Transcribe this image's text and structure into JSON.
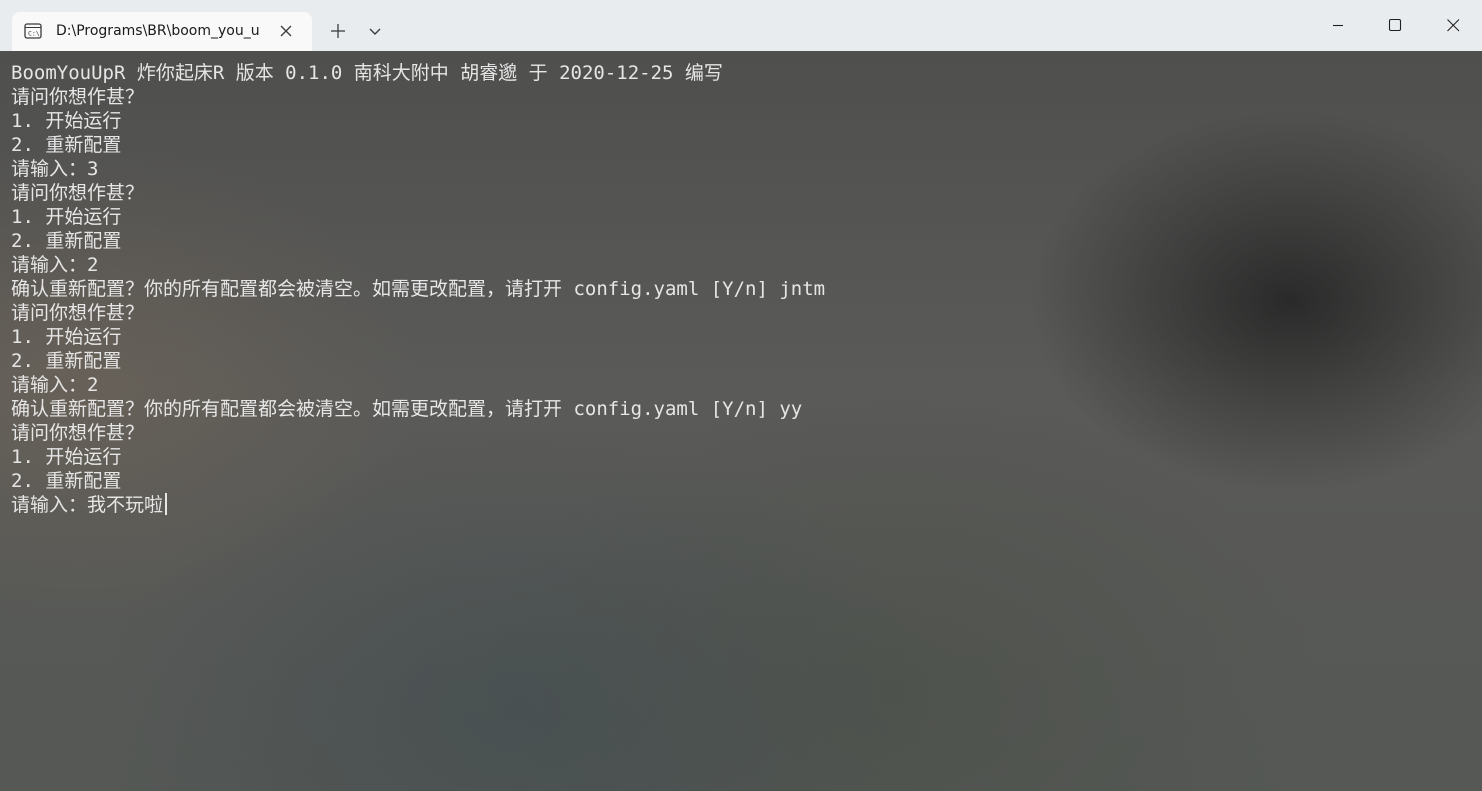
{
  "window": {
    "tab_title": "D:\\Programs\\BR\\boom_you_u",
    "icons": {
      "tab": "terminal-icon",
      "close_tab": "close-icon",
      "new_tab": "plus-icon",
      "dropdown": "chevron-down-icon",
      "minimize": "minimize-icon",
      "maximize": "maximize-icon",
      "close_window": "close-icon"
    }
  },
  "terminal": {
    "lines": [
      "BoomYouUpR 炸你起床R 版本 0.1.0 南科大附中 胡睿邈 于 2020-12-25 编写",
      "请问你想作甚？",
      "1. 开始运行",
      "2. 重新配置",
      "请输入：3",
      "请问你想作甚？",
      "1. 开始运行",
      "2. 重新配置",
      "请输入：2",
      "确认重新配置？你的所有配置都会被清空。如需更改配置，请打开 config.yaml [Y/n] jntm",
      "请问你想作甚？",
      "1. 开始运行",
      "2. 重新配置",
      "请输入：2",
      "确认重新配置？你的所有配置都会被清空。如需更改配置，请打开 config.yaml [Y/n] yy",
      "请问你想作甚？",
      "1. 开始运行",
      "2. 重新配置",
      "请输入：我不玩啦"
    ]
  },
  "colors": {
    "titlebar_bg": "#e9ecef",
    "tab_bg": "#f9f9f9",
    "terminal_text": "#e6e6e6"
  }
}
